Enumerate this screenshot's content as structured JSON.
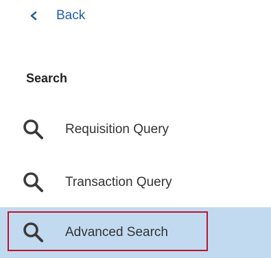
{
  "back": {
    "label": "Back"
  },
  "section": {
    "title": "Search"
  },
  "items": [
    {
      "label": "Requisition Query",
      "icon": "search-icon"
    },
    {
      "label": "Transaction Query",
      "icon": "search-icon"
    },
    {
      "label": "Advanced Search",
      "icon": "search-icon",
      "selected": true
    }
  ],
  "colors": {
    "link": "#1f5ea8",
    "selected_bg": "#c2daf0",
    "highlight_border": "#b9142b",
    "icon": "#3a3a3a"
  }
}
